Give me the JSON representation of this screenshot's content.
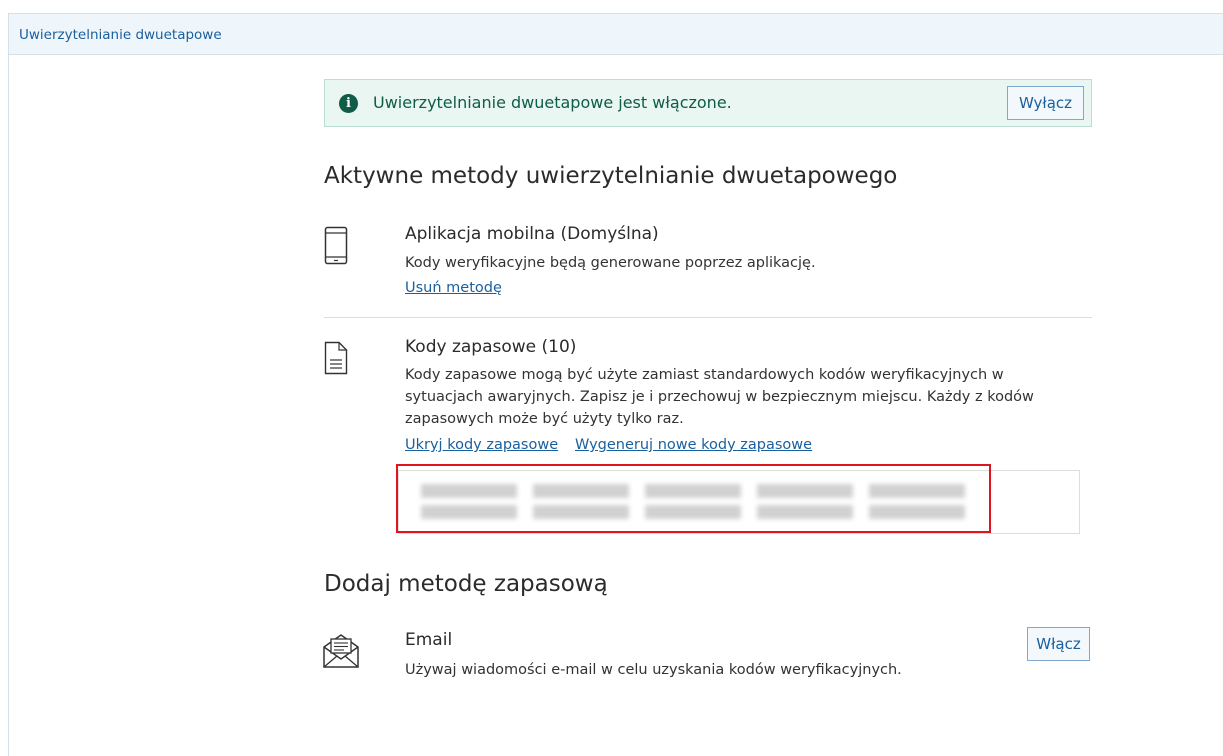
{
  "header": {
    "title": "Uwierzytelnianie dwuetapowe"
  },
  "alert": {
    "icon": "info-circle-icon",
    "text": "Uwierzytelnianie dwuetapowe jest włączone.",
    "button_label": "Wyłącz",
    "bg_color": "#e9f6f2",
    "text_color": "#0f5c47"
  },
  "active_methods": {
    "heading": "Aktywne metody uwierzytelnianie dwuetapowego",
    "mobile": {
      "icon": "mobile-phone-icon",
      "title": "Aplikacja mobilna (Domyślna)",
      "description": "Kody weryfikacyjne będą generowane poprzez aplikację.",
      "remove_link": "Usuń metodę"
    },
    "backup_codes": {
      "icon": "document-icon",
      "title": "Kody zapasowe (10)",
      "description_lines": [
        "Kody zapasowe mogą być użyte zamiast standardowych kodów weryfikacyjnych w",
        "sytuacjach awaryjnych. Zapisz je i przechowuj w bezpiecznym miejscu. Każdy z kodów",
        "zapasowych może być użyty tylko raz."
      ],
      "hide_link": "Ukryj kody zapasowe",
      "regenerate_link": "Wygeneruj nowe kody zapasowe",
      "codes_note": "10 blurred codes"
    }
  },
  "add_method": {
    "heading": "Dodaj metodę zapasową",
    "email": {
      "icon": "envelope-open-icon",
      "title": "Email",
      "description": "Używaj wiadomości e-mail w celu uzyskania kodów weryfikacyjnych.",
      "button_label": "Włącz"
    }
  },
  "colors": {
    "accent": "#1a5f9e",
    "highlight_border": "#e0141e"
  }
}
